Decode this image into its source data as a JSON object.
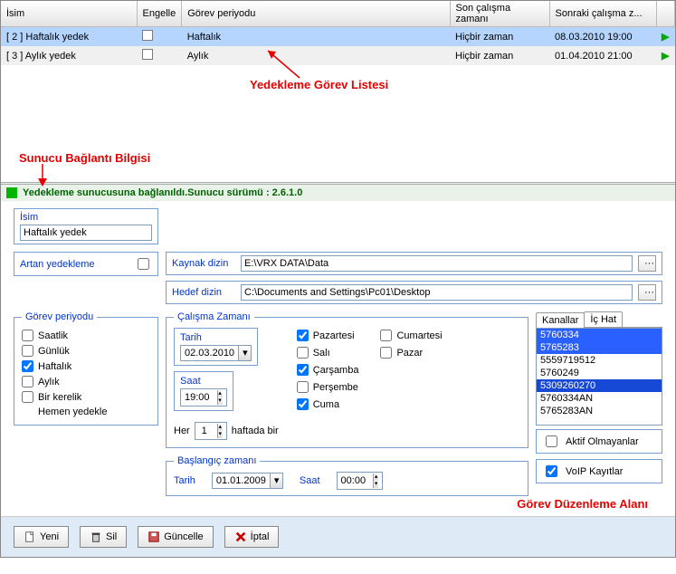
{
  "columns": {
    "name": "İsim",
    "disable": "Engelle",
    "period": "Görev periyodu",
    "last": "Son çalışma zamanı",
    "next": "Sonraki çalışma z..."
  },
  "tasks": [
    {
      "id": "[ 2 ]  Haftalık yedek",
      "period": "Haftalık",
      "last": "Hiçbir zaman",
      "next": "08.03.2010 19:00"
    },
    {
      "id": "[ 3 ]  Aylık yedek",
      "period": "Aylık",
      "last": "Hiçbir zaman",
      "next": "01.04.2010 21:00"
    }
  ],
  "annotations": {
    "list": "Yedekleme Görev Listesi",
    "conn": "Sunucu Bağlantı Bilgisi",
    "edit": "Görev Düzenleme Alanı"
  },
  "status": "Yedekleme sunucusuna bağlanıldı.Sunucu sürümü : 2.6.1.0",
  "labels": {
    "isim": "İsim",
    "artan": "Artan yedekleme",
    "kaynak": "Kaynak dizin",
    "hedef": "Hedef dizin",
    "periyod": "Görev periyodu",
    "saatlik": "Saatlik",
    "gunluk": "Günlük",
    "haftalik": "Haftalık",
    "aylik": "Aylık",
    "birkerelik": "Bir kerelik",
    "hemen": "Hemen yedekle",
    "calisma": "Çalışma Zamanı",
    "tarih": "Tarih",
    "saat": "Saat",
    "her": "Her",
    "haftada": "haftada bir",
    "pazartesi": "Pazartesi",
    "sali": "Salı",
    "carsamba": "Çarşamba",
    "persembe": "Perşembe",
    "cuma": "Cuma",
    "cumartesi": "Cumartesi",
    "pazar": "Pazar",
    "baslangic": "Başlangıç zamanı",
    "kanallar": "Kanallar",
    "ichat": "İç Hat",
    "aktif": "Aktif Olmayanlar",
    "voip": "VoIP Kayıtlar",
    "yeni": "Yeni",
    "sil": "Sil",
    "guncelle": "Güncelle",
    "iptal": "İptal"
  },
  "values": {
    "taskName": "Haftalık yedek",
    "kaynak": "E:\\VRX DATA\\Data",
    "hedef": "C:\\Documents and Settings\\Pc01\\Desktop",
    "tarih": "02.03.2010",
    "saat": "19:00",
    "her": "1",
    "basTarih": "01.01.2009",
    "basSaat": "00:00"
  },
  "channels": [
    "5760334",
    "5765283",
    "5559719512",
    "5760249",
    "5309260270",
    "5760334AN",
    "5765283AN"
  ]
}
